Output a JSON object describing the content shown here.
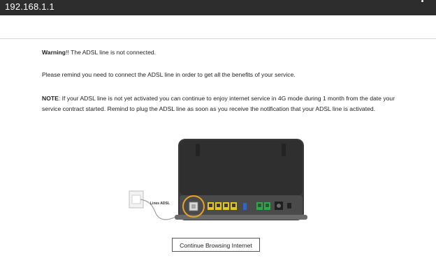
{
  "titlebar": {
    "address": "192.168.1.1"
  },
  "message": {
    "warning_label": "Warning",
    "warning_text": "!! The ADSL line is not connected.",
    "remind_text": "Please remind you need to connect the ADSL line in order to get all the benefits of your service.",
    "note_label": "NOTE",
    "note_text": ": If your ADSL line is not yet activated you can continue to enjoy internet service in 4G mode during 1 month from the date your service contract started. Remind to plug the ADSL line as soon as you receive the notification that your ADSL line is activated."
  },
  "illustration": {
    "cable_label": "Lines ADSL",
    "highlight_color": "#e8a22a",
    "lan_port_color": "#e6c619",
    "phone_port_color": "#2fa84a",
    "usb_port_color": "#2f67c9"
  },
  "actions": {
    "continue_label": "Continue Browsing Internet"
  }
}
